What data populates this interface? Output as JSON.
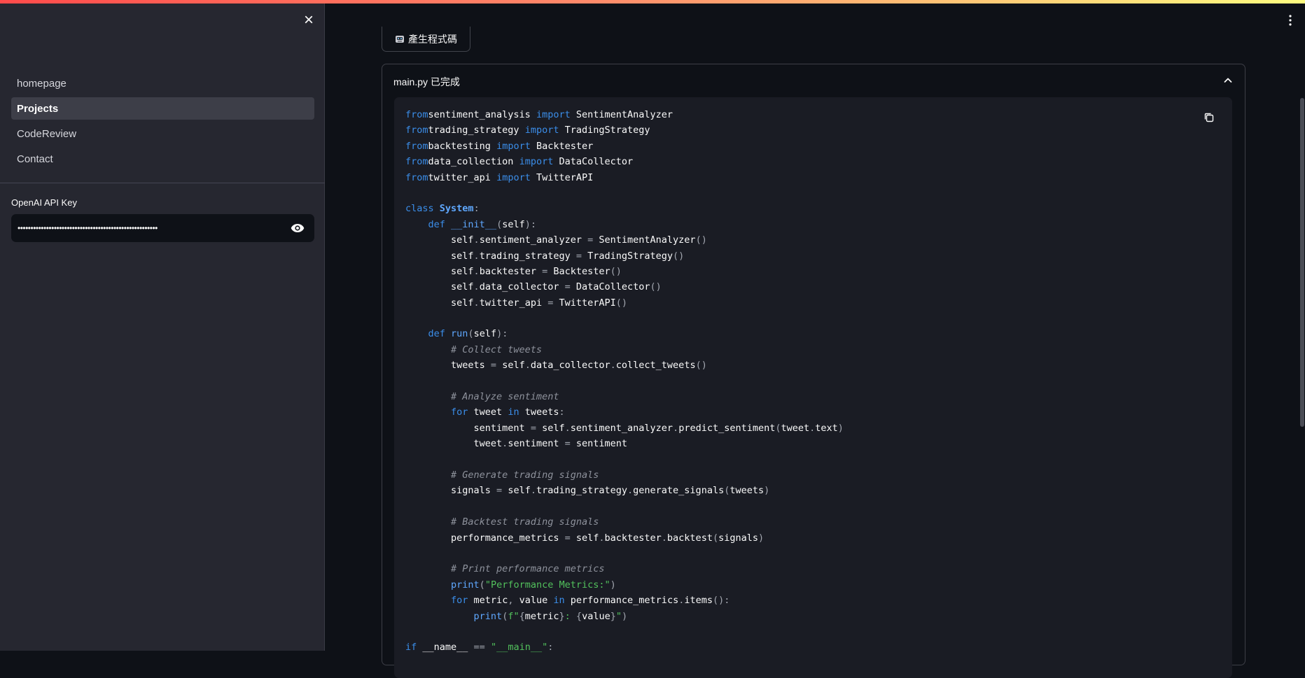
{
  "sidebar": {
    "nav_items": [
      {
        "label": "homepage",
        "active": false
      },
      {
        "label": "Projects",
        "active": true
      },
      {
        "label": "CodeReview",
        "active": false
      },
      {
        "label": "Contact",
        "active": false
      }
    ],
    "api_key_label": "OpenAI API Key",
    "api_key_value": "••••••••••••••••••••••••••••••••••••••••••••••••••••••"
  },
  "main": {
    "generate_button_label": "產生程式碼",
    "expander_title": "main.py 已完成"
  },
  "icons": {
    "close": "close-icon",
    "eye": "eye-icon",
    "robot": "robot-icon",
    "kebab": "kebab-menu-icon",
    "chevron": "chevron-up-icon",
    "copy": "copy-icon"
  },
  "colors": {
    "background": "#0e1117",
    "sidebar": "#262730",
    "keyword": "#3b8eea",
    "string": "#52c15c",
    "comment": "#8e929c"
  },
  "code": {
    "language": "python",
    "lines": [
      [
        [
          "kw",
          "from"
        ],
        [
          "",
          "sentiment_analysis "
        ],
        [
          "kw",
          "import"
        ],
        [
          "",
          " SentimentAnalyzer"
        ]
      ],
      [
        [
          "kw",
          "from"
        ],
        [
          "",
          "trading_strategy "
        ],
        [
          "kw",
          "import"
        ],
        [
          "",
          " TradingStrategy"
        ]
      ],
      [
        [
          "kw",
          "from"
        ],
        [
          "",
          "backtesting "
        ],
        [
          "kw",
          "import"
        ],
        [
          "",
          " Backtester"
        ]
      ],
      [
        [
          "kw",
          "from"
        ],
        [
          "",
          "data_collection "
        ],
        [
          "kw",
          "import"
        ],
        [
          "",
          " DataCollector"
        ]
      ],
      [
        [
          "kw",
          "from"
        ],
        [
          "",
          "twitter_api "
        ],
        [
          "kw",
          "import"
        ],
        [
          "",
          " TwitterAPI"
        ]
      ],
      [],
      [
        [
          "kw",
          "class"
        ],
        [
          "",
          " "
        ],
        [
          "cls",
          "System"
        ],
        [
          "pu",
          ":"
        ]
      ],
      [
        [
          "",
          "    "
        ],
        [
          "kw",
          "def"
        ],
        [
          "",
          " "
        ],
        [
          "fn",
          "__init__"
        ],
        [
          "pu",
          "("
        ],
        [
          "",
          "self"
        ],
        [
          "pu",
          "):"
        ]
      ],
      [
        [
          "",
          "        self"
        ],
        [
          "pu",
          "."
        ],
        [
          "",
          "sentiment_analyzer "
        ],
        [
          "pu",
          "="
        ],
        [
          "",
          " SentimentAnalyzer"
        ],
        [
          "pu",
          "()"
        ]
      ],
      [
        [
          "",
          "        self"
        ],
        [
          "pu",
          "."
        ],
        [
          "",
          "trading_strategy "
        ],
        [
          "pu",
          "="
        ],
        [
          "",
          " TradingStrategy"
        ],
        [
          "pu",
          "()"
        ]
      ],
      [
        [
          "",
          "        self"
        ],
        [
          "pu",
          "."
        ],
        [
          "",
          "backtester "
        ],
        [
          "pu",
          "="
        ],
        [
          "",
          " Backtester"
        ],
        [
          "pu",
          "()"
        ]
      ],
      [
        [
          "",
          "        self"
        ],
        [
          "pu",
          "."
        ],
        [
          "",
          "data_collector "
        ],
        [
          "pu",
          "="
        ],
        [
          "",
          " DataCollector"
        ],
        [
          "pu",
          "()"
        ]
      ],
      [
        [
          "",
          "        self"
        ],
        [
          "pu",
          "."
        ],
        [
          "",
          "twitter_api "
        ],
        [
          "pu",
          "="
        ],
        [
          "",
          " TwitterAPI"
        ],
        [
          "pu",
          "()"
        ]
      ],
      [],
      [
        [
          "",
          "    "
        ],
        [
          "kw",
          "def"
        ],
        [
          "",
          " "
        ],
        [
          "fn",
          "run"
        ],
        [
          "pu",
          "("
        ],
        [
          "",
          "self"
        ],
        [
          "pu",
          "):"
        ]
      ],
      [
        [
          "cm",
          "        # Collect tweets"
        ]
      ],
      [
        [
          "",
          "        tweets "
        ],
        [
          "pu",
          "="
        ],
        [
          "",
          " self"
        ],
        [
          "pu",
          "."
        ],
        [
          "",
          "data_collector"
        ],
        [
          "pu",
          "."
        ],
        [
          "",
          "collect_tweets"
        ],
        [
          "pu",
          "()"
        ]
      ],
      [],
      [
        [
          "cm",
          "        # Analyze sentiment"
        ]
      ],
      [
        [
          "",
          "        "
        ],
        [
          "kw",
          "for"
        ],
        [
          "",
          " tweet "
        ],
        [
          "kw",
          "in"
        ],
        [
          "",
          " tweets"
        ],
        [
          "pu",
          ":"
        ]
      ],
      [
        [
          "",
          "            sentiment "
        ],
        [
          "pu",
          "="
        ],
        [
          "",
          " self"
        ],
        [
          "pu",
          "."
        ],
        [
          "",
          "sentiment_analyzer"
        ],
        [
          "pu",
          "."
        ],
        [
          "",
          "predict_sentiment"
        ],
        [
          "pu",
          "("
        ],
        [
          "",
          "tweet"
        ],
        [
          "pu",
          "."
        ],
        [
          "",
          "text"
        ],
        [
          "pu",
          ")"
        ]
      ],
      [
        [
          "",
          "            tweet"
        ],
        [
          "pu",
          "."
        ],
        [
          "",
          "sentiment "
        ],
        [
          "pu",
          "="
        ],
        [
          "",
          " sentiment"
        ]
      ],
      [],
      [
        [
          "cm",
          "        # Generate trading signals"
        ]
      ],
      [
        [
          "",
          "        signals "
        ],
        [
          "pu",
          "="
        ],
        [
          "",
          " self"
        ],
        [
          "pu",
          "."
        ],
        [
          "",
          "trading_strategy"
        ],
        [
          "pu",
          "."
        ],
        [
          "",
          "generate_signals"
        ],
        [
          "pu",
          "("
        ],
        [
          "",
          "tweets"
        ],
        [
          "pu",
          ")"
        ]
      ],
      [],
      [
        [
          "cm",
          "        # Backtest trading signals"
        ]
      ],
      [
        [
          "",
          "        performance_metrics "
        ],
        [
          "pu",
          "="
        ],
        [
          "",
          " self"
        ],
        [
          "pu",
          "."
        ],
        [
          "",
          "backtester"
        ],
        [
          "pu",
          "."
        ],
        [
          "",
          "backtest"
        ],
        [
          "pu",
          "("
        ],
        [
          "",
          "signals"
        ],
        [
          "pu",
          ")"
        ]
      ],
      [],
      [
        [
          "cm",
          "        # Print performance metrics"
        ]
      ],
      [
        [
          "",
          "        "
        ],
        [
          "fn",
          "print"
        ],
        [
          "pu",
          "("
        ],
        [
          "st",
          "\"Performance Metrics:\""
        ],
        [
          "pu",
          ")"
        ]
      ],
      [
        [
          "",
          "        "
        ],
        [
          "kw",
          "for"
        ],
        [
          "",
          " metric"
        ],
        [
          "pu",
          ","
        ],
        [
          "",
          " value "
        ],
        [
          "kw",
          "in"
        ],
        [
          "",
          " performance_metrics"
        ],
        [
          "pu",
          "."
        ],
        [
          "",
          "items"
        ],
        [
          "pu",
          "():"
        ]
      ],
      [
        [
          "",
          "            "
        ],
        [
          "fn",
          "print"
        ],
        [
          "pu",
          "("
        ],
        [
          "st",
          "f\""
        ],
        [
          "pu",
          "{"
        ],
        [
          "",
          "metric"
        ],
        [
          "pu",
          "}"
        ],
        [
          "st",
          ": "
        ],
        [
          "pu",
          "{"
        ],
        [
          "",
          "value"
        ],
        [
          "pu",
          "}"
        ],
        [
          "st",
          "\""
        ],
        [
          "pu",
          ")"
        ]
      ],
      [],
      [
        [
          "kw",
          "if"
        ],
        [
          "",
          " __name__ "
        ],
        [
          "pu",
          "=="
        ],
        [
          "",
          " "
        ],
        [
          "st",
          "\"__main__\""
        ],
        [
          "pu",
          ":"
        ]
      ]
    ]
  }
}
